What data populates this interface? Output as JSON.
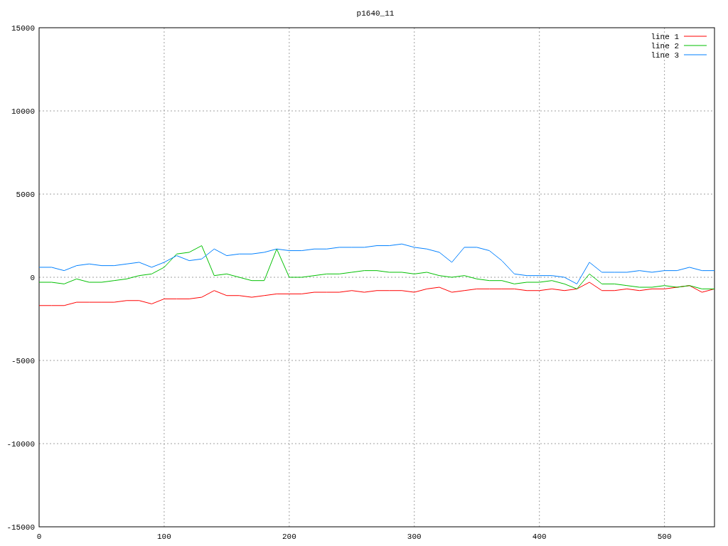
{
  "chart": {
    "chart_data": {
      "type": "line",
      "title": "p1640_11",
      "x": [
        0,
        10,
        20,
        30,
        40,
        50,
        60,
        70,
        80,
        90,
        100,
        110,
        120,
        130,
        140,
        150,
        160,
        170,
        180,
        190,
        200,
        210,
        220,
        230,
        240,
        250,
        260,
        270,
        280,
        290,
        300,
        310,
        320,
        330,
        340,
        350,
        360,
        370,
        380,
        390,
        400,
        410,
        420,
        430,
        440,
        450,
        460,
        470,
        480,
        490,
        500,
        510,
        520,
        530,
        540
      ],
      "series": [
        {
          "name": "line 1",
          "color": "#ff0000",
          "values": [
            -1700,
            -1700,
            -1700,
            -1500,
            -1500,
            -1500,
            -1500,
            -1400,
            -1400,
            -1600,
            -1300,
            -1300,
            -1300,
            -1200,
            -800,
            -1100,
            -1100,
            -1200,
            -1100,
            -1000,
            -1000,
            -1000,
            -900,
            -900,
            -900,
            -800,
            -900,
            -800,
            -800,
            -800,
            -900,
            -700,
            -600,
            -900,
            -800,
            -700,
            -700,
            -700,
            -700,
            -800,
            -800,
            -700,
            -800,
            -700,
            -300,
            -800,
            -800,
            -700,
            -800,
            -700,
            -700,
            -600,
            -500,
            -900,
            -700
          ]
        },
        {
          "name": "line 2",
          "color": "#00c000",
          "values": [
            -300,
            -300,
            -400,
            -100,
            -300,
            -300,
            -200,
            -100,
            100,
            200,
            600,
            1400,
            1500,
            1900,
            100,
            200,
            0,
            -200,
            -200,
            1700,
            0,
            0,
            100,
            200,
            200,
            300,
            400,
            400,
            300,
            300,
            200,
            300,
            100,
            0,
            100,
            -100,
            -200,
            -200,
            -400,
            -300,
            -300,
            -200,
            -400,
            -700,
            200,
            -400,
            -400,
            -500,
            -600,
            -600,
            -500,
            -600,
            -500,
            -700,
            -700
          ]
        },
        {
          "name": "line 3",
          "color": "#0080ff",
          "values": [
            600,
            600,
            400,
            700,
            800,
            700,
            700,
            800,
            900,
            600,
            900,
            1300,
            1000,
            1100,
            1700,
            1300,
            1400,
            1400,
            1500,
            1700,
            1600,
            1600,
            1700,
            1700,
            1800,
            1800,
            1800,
            1900,
            1900,
            2000,
            1800,
            1700,
            1500,
            900,
            1800,
            1800,
            1600,
            1000,
            200,
            100,
            100,
            100,
            0,
            -400,
            900,
            300,
            300,
            300,
            400,
            300,
            400,
            400,
            600,
            400,
            400
          ]
        }
      ],
      "xlim": [
        0,
        540
      ],
      "ylim": [
        -15000,
        15000
      ],
      "xticks": [
        0,
        100,
        200,
        300,
        400,
        500
      ],
      "yticks": [
        -15000,
        -10000,
        -5000,
        0,
        5000,
        10000,
        15000
      ],
      "grid": true,
      "legend": true
    }
  }
}
